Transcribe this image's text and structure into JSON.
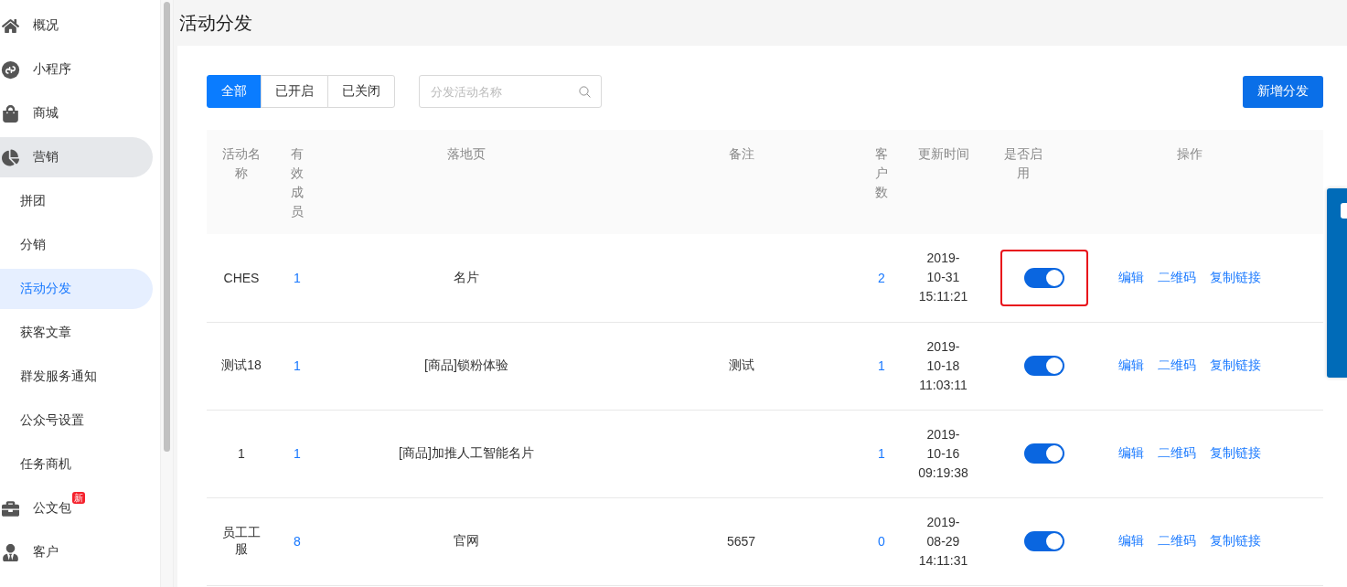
{
  "sidebar": {
    "items": [
      {
        "label": "概况",
        "kind": "top",
        "selected": false
      },
      {
        "label": "小程序",
        "kind": "top",
        "selected": false
      },
      {
        "label": "商城",
        "kind": "top",
        "selected": false
      },
      {
        "label": "营销",
        "kind": "top",
        "selected": false,
        "expanded": true
      },
      {
        "label": "拼团",
        "kind": "sub",
        "selected": false
      },
      {
        "label": "分销",
        "kind": "sub",
        "selected": false
      },
      {
        "label": "活动分发",
        "kind": "sub",
        "selected": true
      },
      {
        "label": "获客文章",
        "kind": "sub",
        "selected": false
      },
      {
        "label": "群发服务通知",
        "kind": "sub",
        "selected": false
      },
      {
        "label": "公众号设置",
        "kind": "sub",
        "selected": false
      },
      {
        "label": "任务商机",
        "kind": "sub",
        "selected": false
      },
      {
        "label": "公文包",
        "kind": "top",
        "selected": false,
        "badge": "新"
      },
      {
        "label": "客户",
        "kind": "top",
        "selected": false
      }
    ]
  },
  "page": {
    "title": "活动分发"
  },
  "filters": {
    "tabs": [
      {
        "label": "全部",
        "selected": true
      },
      {
        "label": "已开启",
        "selected": false
      },
      {
        "label": "已关闭",
        "selected": false
      }
    ],
    "search": {
      "placeholder": "分发活动名称"
    },
    "add_button": "新增分发"
  },
  "table": {
    "columns": [
      "活动名称",
      "有效成员",
      "落地页",
      "备注",
      "客户数",
      "更新时间",
      "是否启用",
      "操作"
    ],
    "rows": [
      {
        "name": "CHES",
        "members": "1",
        "landing": "名片",
        "remark": "",
        "customers": "2",
        "updated": "2019-10-31 15:11:21",
        "enabled": true,
        "highlighted": true,
        "actions": [
          "编辑",
          "二维码",
          "复制链接"
        ]
      },
      {
        "name": "测试18",
        "members": "1",
        "landing": "[商品]锁粉体验",
        "remark": "测试",
        "customers": "1",
        "updated": "2019-10-18 11:03:11",
        "enabled": true,
        "highlighted": false,
        "actions": [
          "编辑",
          "二维码",
          "复制链接"
        ]
      },
      {
        "name": "1",
        "members": "1",
        "landing": "[商品]加推人工智能名片",
        "remark": "",
        "customers": "1",
        "updated": "2019-10-16 09:19:38",
        "enabled": true,
        "highlighted": false,
        "actions": [
          "编辑",
          "二维码",
          "复制链接"
        ]
      },
      {
        "name": "员工工服",
        "members": "8",
        "landing": "官网",
        "remark": "5657",
        "customers": "0",
        "updated": "2019-08-29 14:11:31",
        "enabled": true,
        "highlighted": false,
        "actions": [
          "编辑",
          "二维码",
          "复制链接"
        ]
      }
    ]
  }
}
